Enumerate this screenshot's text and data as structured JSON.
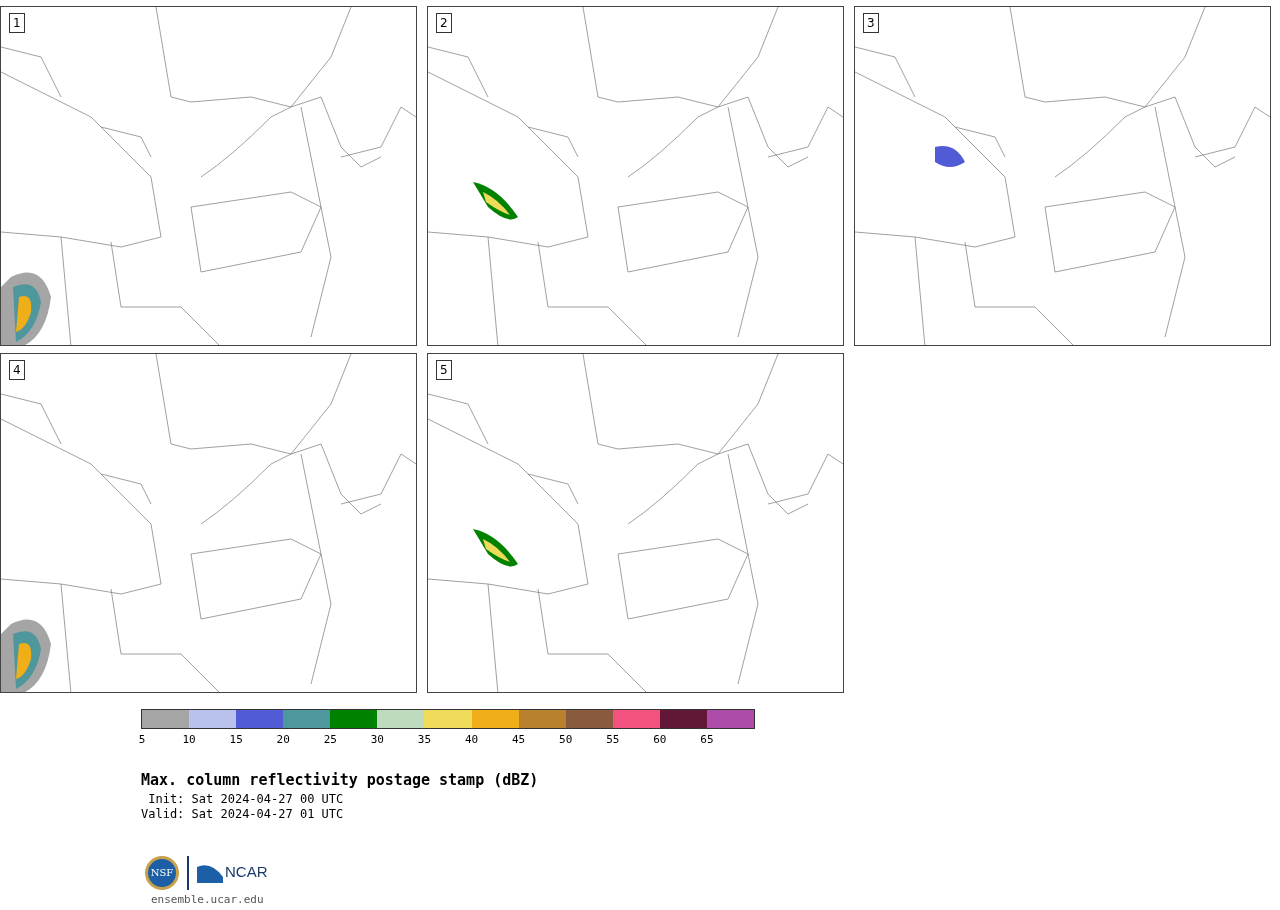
{
  "panels": [
    {
      "label": "1"
    },
    {
      "label": "2"
    },
    {
      "label": "3"
    },
    {
      "label": "4"
    },
    {
      "label": "5"
    }
  ],
  "colorbar": {
    "bins": [
      {
        "color": "#a5a5a5"
      },
      {
        "color": "#b8c2ec"
      },
      {
        "color": "#515bd6"
      },
      {
        "color": "#4e979d"
      },
      {
        "color": "#008200"
      },
      {
        "color": "#bedcbd"
      },
      {
        "color": "#efdb5a"
      },
      {
        "color": "#f0ae18"
      },
      {
        "color": "#b9812e"
      },
      {
        "color": "#8a5a3e"
      },
      {
        "color": "#f4527e"
      },
      {
        "color": "#621736"
      },
      {
        "color": "#ad4ca9"
      }
    ],
    "ticks": [
      "5",
      "10",
      "15",
      "20",
      "25",
      "30",
      "35",
      "40",
      "45",
      "50",
      "55",
      "60",
      "65"
    ]
  },
  "title": "Max. column reflectivity postage stamp (dBZ)",
  "init": " Init: Sat 2024-04-27 00 UTC",
  "valid": "Valid: Sat 2024-04-27 01 UTC",
  "logo": {
    "nsf": "NSF",
    "ncar": "NCAR"
  },
  "url": "ensemble.ucar.edu"
}
